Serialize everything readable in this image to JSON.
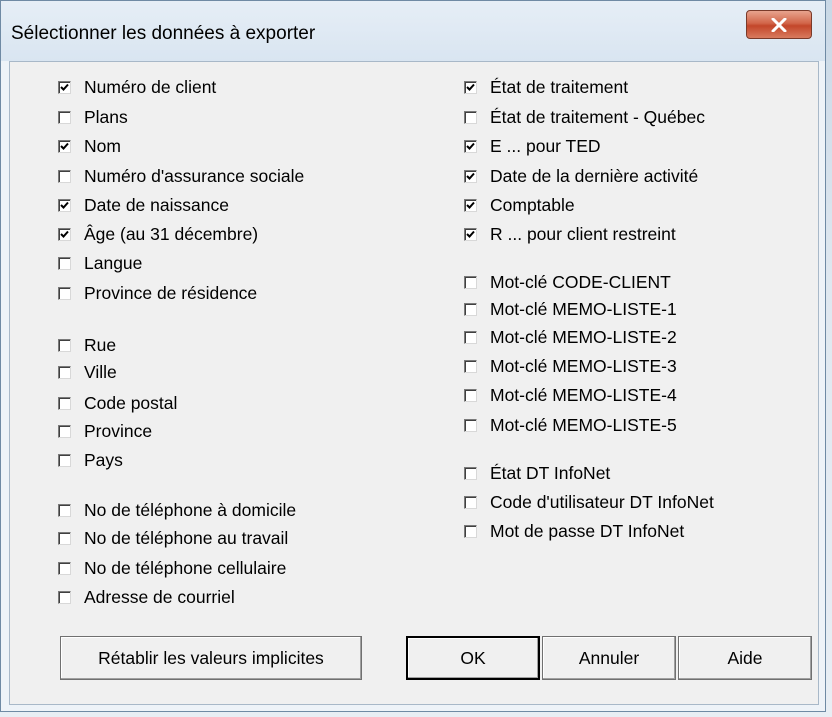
{
  "window": {
    "title": "Sélectionner les données à exporter",
    "close_icon": "close-icon"
  },
  "left_column": [
    {
      "label": "Numéro de client",
      "checked": true
    },
    {
      "label": "Plans",
      "checked": false
    },
    {
      "label": "Nom",
      "checked": true
    },
    {
      "label": "Numéro d'assurance sociale",
      "checked": false
    },
    {
      "label": "Date de naissance",
      "checked": true
    },
    {
      "label": "Âge (au 31 décembre)",
      "checked": true
    },
    {
      "label": "Langue",
      "checked": false
    },
    {
      "label": "Province de résidence",
      "checked": false
    },
    {
      "label": "Rue",
      "checked": false
    },
    {
      "label": "Ville",
      "checked": false
    },
    {
      "label": "Code postal",
      "checked": false
    },
    {
      "label": "Province",
      "checked": false
    },
    {
      "label": "Pays",
      "checked": false
    },
    {
      "label": "No de téléphone à domicile",
      "checked": false
    },
    {
      "label": "No de téléphone au travail",
      "checked": false
    },
    {
      "label": "No de téléphone cellulaire",
      "checked": false
    },
    {
      "label": "Adresse de courriel",
      "checked": false
    }
  ],
  "right_column": [
    {
      "label": "État de traitement",
      "checked": true
    },
    {
      "label": "État de traitement - Québec",
      "checked": false
    },
    {
      "label": "E ... pour TED",
      "checked": true
    },
    {
      "label": "Date de la dernière activité",
      "checked": true
    },
    {
      "label": "Comptable",
      "checked": true
    },
    {
      "label": "R ... pour client restreint",
      "checked": true
    },
    {
      "label": "Mot-clé CODE-CLIENT",
      "checked": false
    },
    {
      "label": "Mot-clé MEMO-LISTE-1",
      "checked": false
    },
    {
      "label": "Mot-clé MEMO-LISTE-2",
      "checked": false
    },
    {
      "label": "Mot-clé MEMO-LISTE-3",
      "checked": false
    },
    {
      "label": "Mot-clé MEMO-LISTE-4",
      "checked": false
    },
    {
      "label": "Mot-clé MEMO-LISTE-5",
      "checked": false
    },
    {
      "label": "État DT InfoNet",
      "checked": false
    },
    {
      "label": "Code d'utilisateur DT InfoNet",
      "checked": false
    },
    {
      "label": "Mot de passe DT InfoNet",
      "checked": false
    }
  ],
  "buttons": {
    "reset": "Rétablir les valeurs implicites",
    "ok": "OK",
    "cancel": "Annuler",
    "help": "Aide"
  }
}
